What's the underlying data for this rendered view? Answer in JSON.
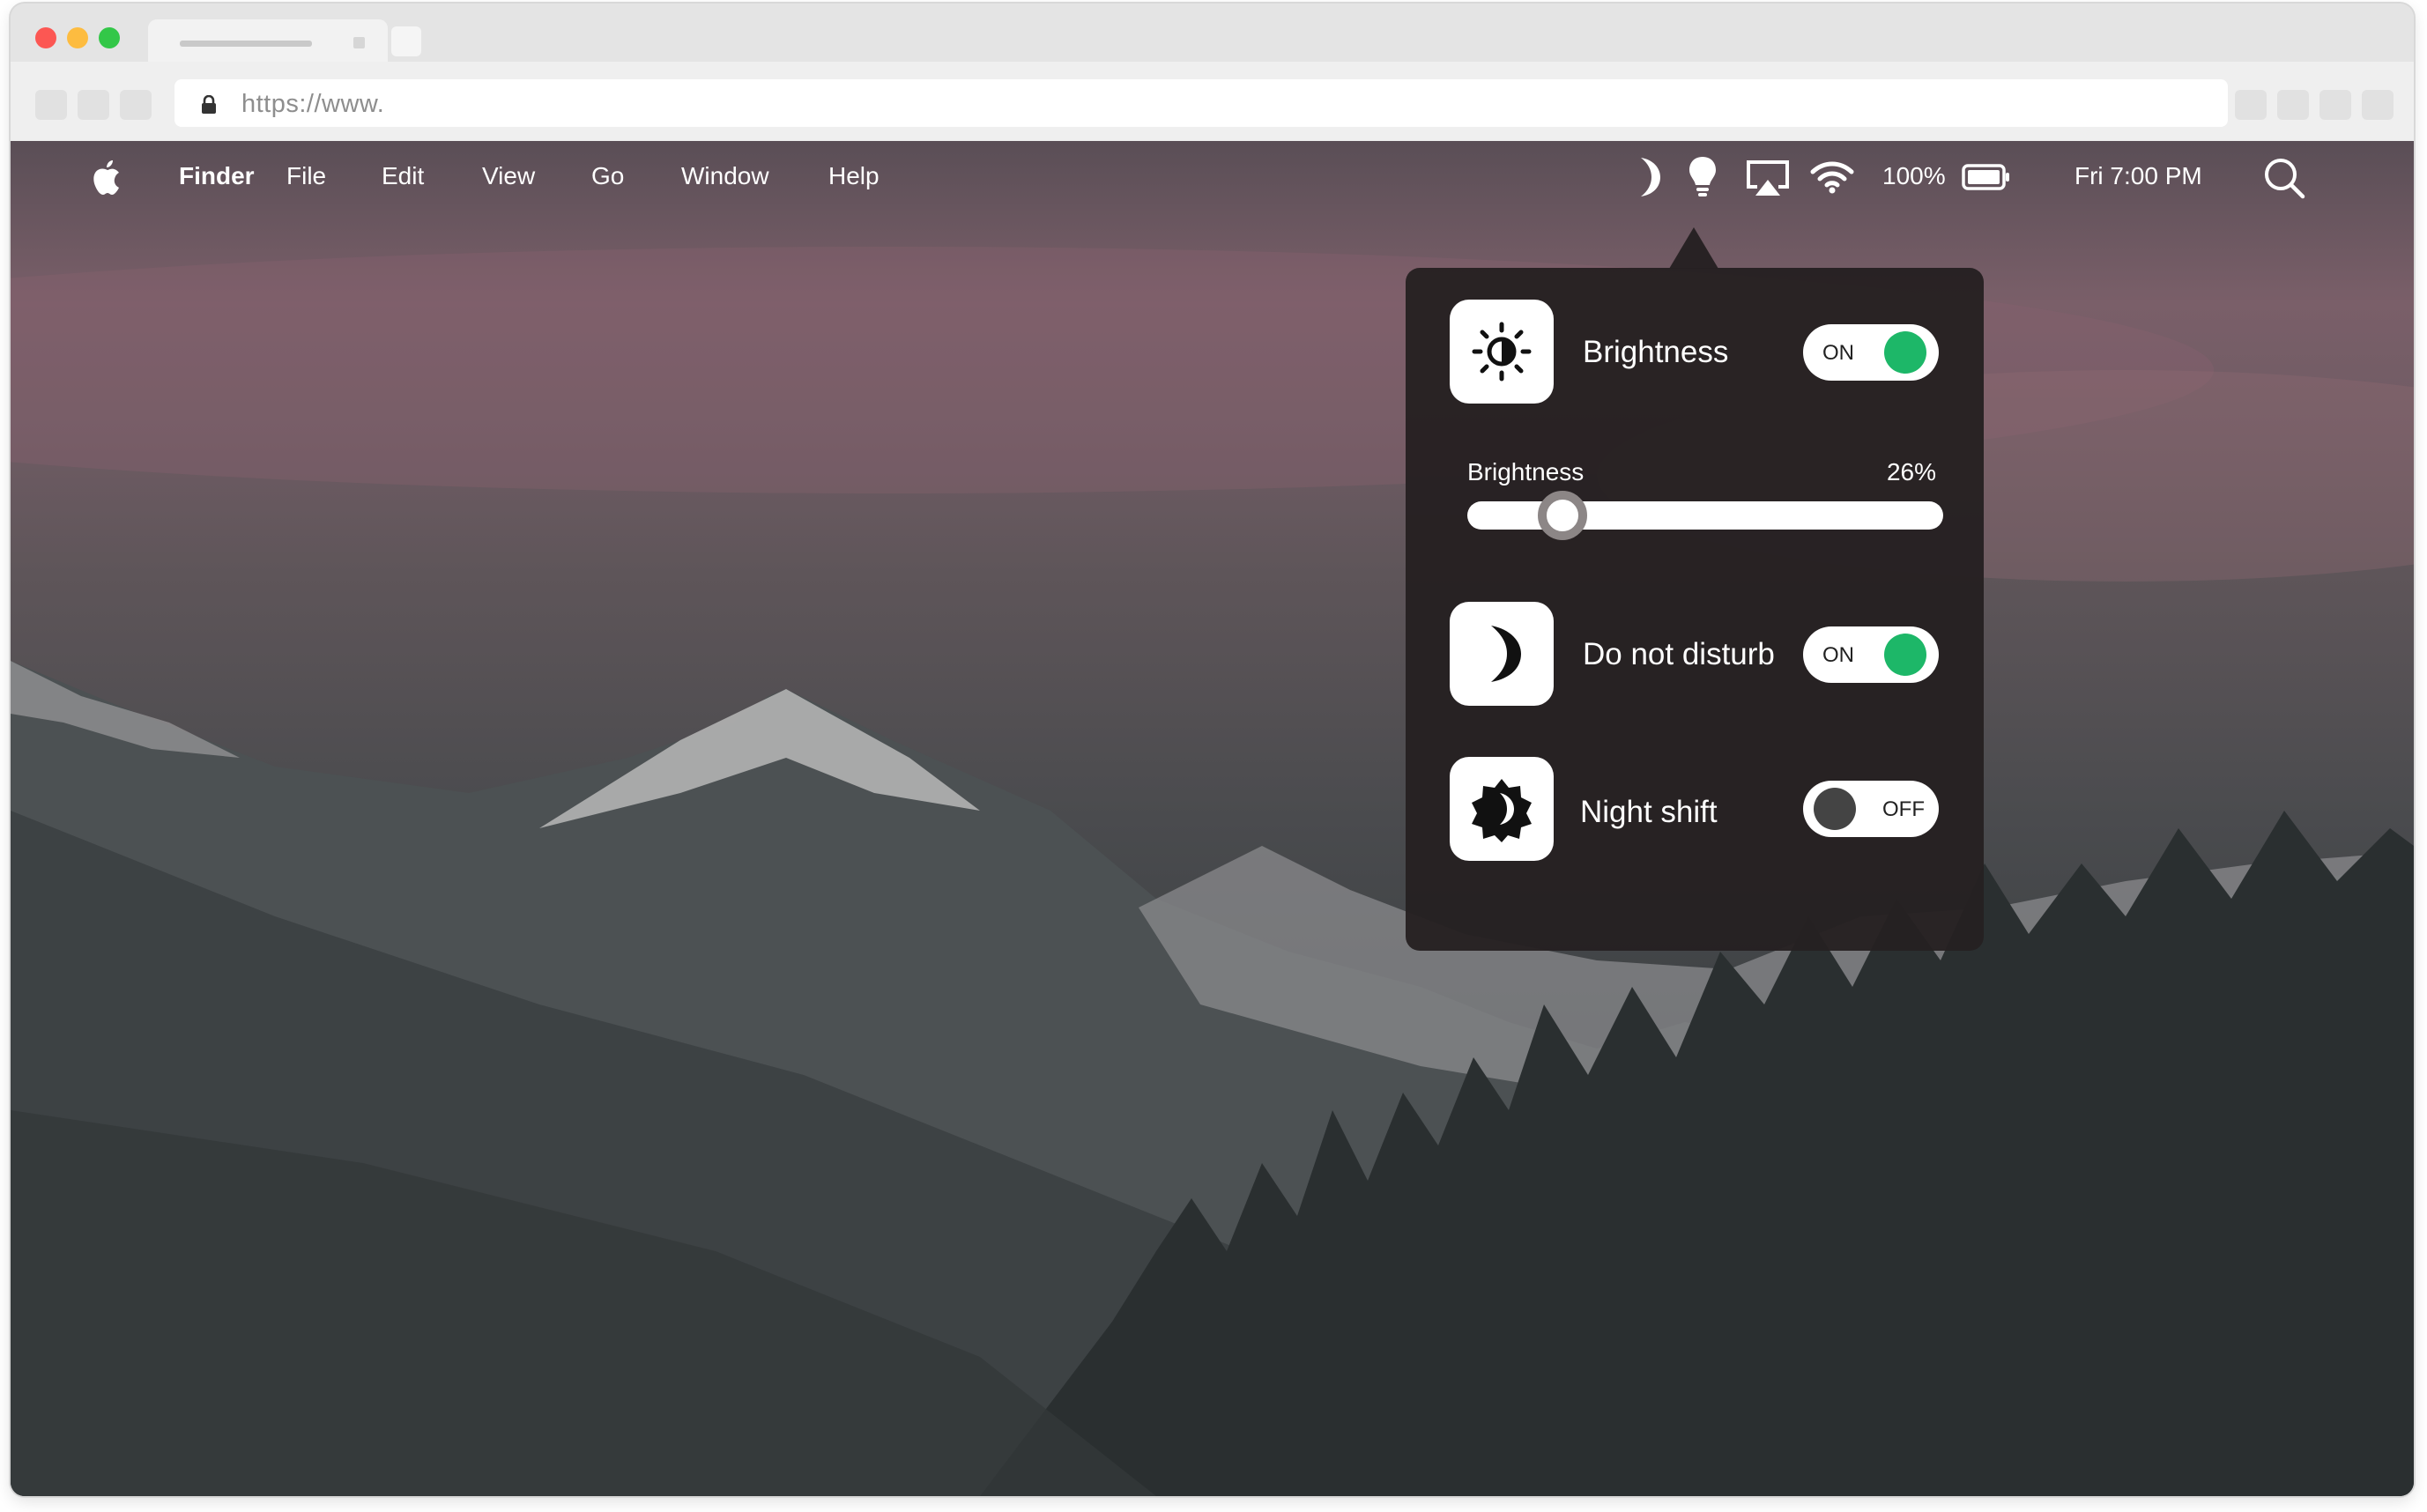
{
  "browser": {
    "url": "https://www."
  },
  "menubar": {
    "app_name": "Finder",
    "items": [
      "File",
      "Edit",
      "View",
      "Go",
      "Window",
      "Help"
    ],
    "battery_percent": "100%",
    "clock": "Fri 7:00 PM",
    "status_icons": [
      "moon-icon",
      "lightbulb-icon",
      "airplay-icon",
      "wifi-icon",
      "battery-icon",
      "search-icon"
    ]
  },
  "popover": {
    "brightness_row": {
      "label": "Brightness",
      "toggle_label": "ON",
      "enabled": true
    },
    "brightness_slider": {
      "label": "Brightness",
      "value_text": "26%",
      "value": 0.2
    },
    "dnd_row": {
      "label": "Do not disturb",
      "toggle_label": "ON",
      "enabled": true
    },
    "night_shift_row": {
      "label": "Night shift",
      "toggle_label": "OFF",
      "enabled": false
    }
  },
  "colors": {
    "toggle_on": "#1db768",
    "toggle_off": "#444444",
    "traffic_red": "#fc5753",
    "traffic_yellow": "#fdbc40",
    "traffic_green": "#33c748"
  }
}
